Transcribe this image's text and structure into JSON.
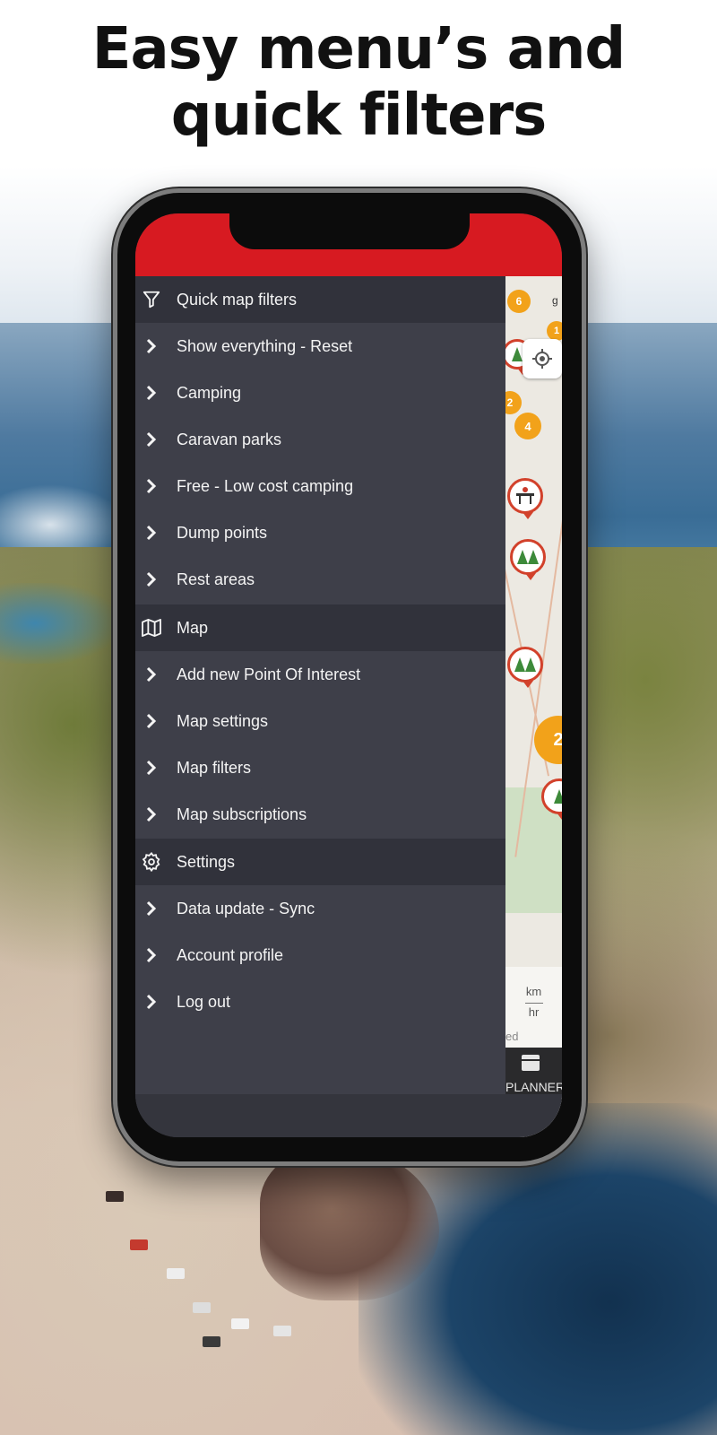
{
  "headline": {
    "line1": "Easy menu’s and",
    "line2": "quick filters"
  },
  "menu": {
    "items": [
      {
        "label": "Quick map filters",
        "type": "section",
        "icon": "filter-icon"
      },
      {
        "label": "Show everything - Reset",
        "type": "item",
        "icon": "chevron-right-icon"
      },
      {
        "label": "Camping",
        "type": "item",
        "icon": "chevron-right-icon"
      },
      {
        "label": "Caravan parks",
        "type": "item",
        "icon": "chevron-right-icon"
      },
      {
        "label": "Free - Low cost camping",
        "type": "item",
        "icon": "chevron-right-icon"
      },
      {
        "label": "Dump points",
        "type": "item",
        "icon": "chevron-right-icon"
      },
      {
        "label": "Rest areas",
        "type": "item",
        "icon": "chevron-right-icon"
      },
      {
        "label": "Map",
        "type": "section",
        "icon": "map-icon"
      },
      {
        "label": "Add new Point Of Interest",
        "type": "item",
        "icon": "chevron-right-icon"
      },
      {
        "label": "Map settings",
        "type": "item",
        "icon": "chevron-right-icon"
      },
      {
        "label": "Map filters",
        "type": "item",
        "icon": "chevron-right-icon"
      },
      {
        "label": "Map subscriptions",
        "type": "item",
        "icon": "chevron-right-icon"
      },
      {
        "label": "Settings",
        "type": "section",
        "icon": "gear-icon"
      },
      {
        "label": "Data update - Sync",
        "type": "item",
        "icon": "chevron-right-icon"
      },
      {
        "label": "Account profile",
        "type": "item",
        "icon": "chevron-right-icon"
      },
      {
        "label": "Log out",
        "type": "item",
        "icon": "chevron-right-icon"
      }
    ]
  },
  "map": {
    "clusters": [
      "6",
      "1",
      "2",
      "4",
      "2"
    ],
    "partial_label": "g",
    "speed_unit_top": "km",
    "speed_unit_bottom": "hr",
    "partial_text": "ed",
    "planner_label": "PLANNER"
  },
  "colors": {
    "status_bar": "#d71a21",
    "drawer_bg": "#3e3f49",
    "section_bg": "#31323b",
    "cluster": "#f2a21a",
    "pin_border": "#d2412b"
  }
}
